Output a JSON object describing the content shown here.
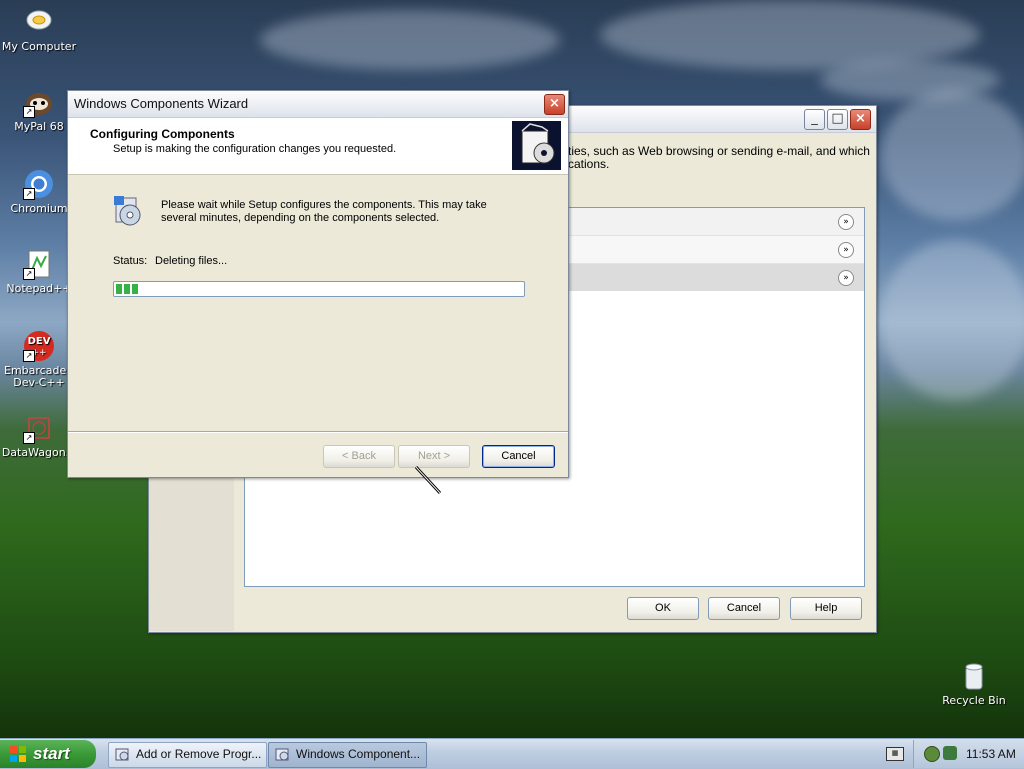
{
  "desktop": {
    "icons": [
      {
        "label": "My Computer",
        "icon": "computer-icon"
      },
      {
        "label": "MyPal 68",
        "icon": "mypal-icon"
      },
      {
        "label": "Chromium",
        "icon": "chromium-icon"
      },
      {
        "label": "Notepad++",
        "icon": "notepadpp-icon"
      },
      {
        "label": "Embarcadero Dev-C++",
        "icon": "devcpp-icon",
        "badge": "DEV"
      },
      {
        "label": "DataWagon...",
        "icon": "datawagon-icon"
      },
      {
        "label": "Recycle Bin",
        "icon": "recycle-bin-icon"
      }
    ]
  },
  "background_window": {
    "description_partial": "ties, such as Web browsing or sending e-mail, and which",
    "description_partial2": "cations.",
    "buttons": {
      "ok": "OK",
      "cancel": "Cancel",
      "help": "Help"
    }
  },
  "wizard": {
    "title": "Windows Components Wizard",
    "header_title": "Configuring Components",
    "header_subtitle": "Setup is making the configuration changes you requested.",
    "message": "Please wait while Setup configures the components. This may take several minutes, depending on the components selected.",
    "status_label": "Status:",
    "status_value": "Deleting files...",
    "progress_fraction": 0.06,
    "buttons": {
      "back": "< Back",
      "next": "Next >",
      "cancel": "Cancel"
    }
  },
  "taskbar": {
    "start_label": "start",
    "tasks": [
      {
        "label": "Add or Remove Progr...",
        "active": false
      },
      {
        "label": "Windows Component...",
        "active": true
      }
    ],
    "clock": "11:53 AM"
  },
  "colors": {
    "accent": "#316ac5",
    "progress": "#36b244",
    "start_green": "#3a9a37"
  }
}
